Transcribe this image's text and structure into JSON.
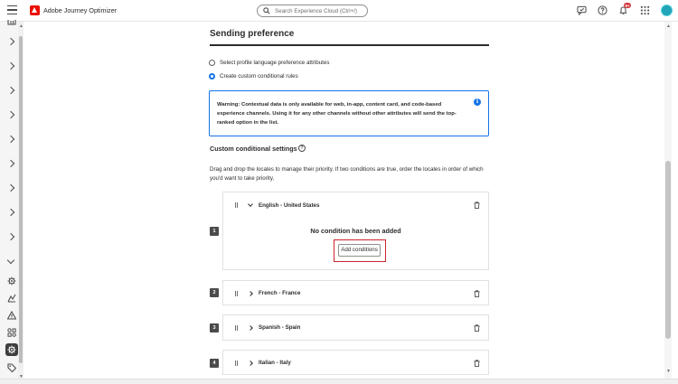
{
  "header": {
    "app_title": "Adobe Journey Optimizer",
    "search_placeholder": "Search Experience Cloud (Ctrl+/)",
    "notification_count": "9+",
    "icons": [
      "menu-icon",
      "adobe-logo-icon",
      "search-icon",
      "feedback-icon",
      "help-icon",
      "bell-icon",
      "apps-grid-icon",
      "avatar"
    ]
  },
  "rail": {
    "icons": [
      "chevron-right-icon",
      "chevron-down-icon",
      "gear-icon",
      "route-icon",
      "alert-icon",
      "components-icon",
      "settings-icon",
      "tag-icon"
    ]
  },
  "section": {
    "title": "Sending preference",
    "options": [
      {
        "label": "Select profile language preference attributes",
        "selected": false
      },
      {
        "label": "Create custom conditional rules",
        "selected": true
      }
    ],
    "warning": "Warning: Contextual data is only available for web, in-app, content card, and code-based experience channels. Using it for any other channels without other attributes will send the top-ranked option in the list.",
    "custom_title": "Custom conditional settings",
    "description": "Drag and drop the locales to manage their priority. If two conditions are true, order the locales in order of which you'd want to take priority."
  },
  "locales": [
    {
      "rank": "1",
      "name": "English - United States",
      "expanded": true,
      "empty_message": "No condition has been added",
      "add_label": "Add conditions"
    },
    {
      "rank": "2",
      "name": "French - France",
      "expanded": false
    },
    {
      "rank": "3",
      "name": "Spanish - Spain",
      "expanded": false
    },
    {
      "rank": "4",
      "name": "Italian - Italy",
      "expanded": false
    }
  ],
  "colors": {
    "accent": "#1473e6",
    "highlight": "#c9252d",
    "brand": "#eb1000"
  }
}
